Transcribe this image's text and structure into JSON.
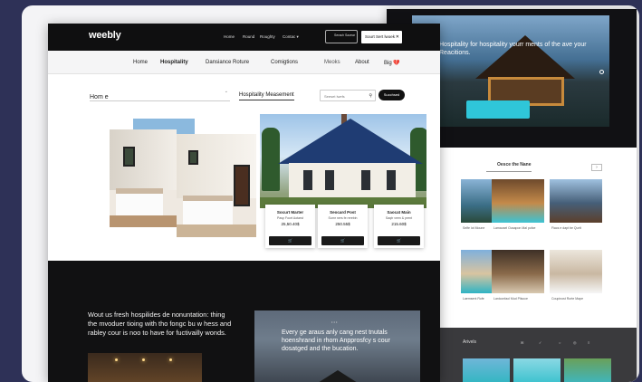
{
  "brand": {
    "logo": "weebly",
    "accent": "#111111",
    "background": "#2e3157"
  },
  "nav_top": {
    "links": [
      "Home",
      "Round",
      "Roughty",
      "Contac ▾"
    ],
    "search_label": "Serach Sazear",
    "cta_label": "Sourt Sert lwoek"
  },
  "nav_main": {
    "items": [
      "Home",
      "Hospitality",
      "Dansiance Roture",
      "Comigtions",
      "Meoks",
      "About",
      "Big 💔"
    ]
  },
  "home_select": {
    "label": "Hom e"
  },
  "marketplace": {
    "title": "Hospitality Measement",
    "search_placeholder": "Seeset lwefs",
    "submit_label": "Succhsed"
  },
  "products": [
    {
      "name": "Socurt Marter",
      "desc": "Pasp Foort Aotarst",
      "price": "25,50.40$"
    },
    {
      "name": "Seocard Post",
      "desc": "Sumr ners fe rerebin",
      "price": "250.55$"
    },
    {
      "name": "Saocat Main",
      "desc": "Saqtr veen & prent",
      "price": "215.60$"
    }
  ],
  "product_button_icon": "cart-icon",
  "dark_section": {
    "paragraph": "Wout us fresh hospilides de nonuntation: thing the mvoduer tioing with tho fongc bu w hess and rabley cour is noo to have for fuctivailly wonds.",
    "quote": "Every ge araus anly cang nest tnutals hoenshrand in rhom Anpprosfcy s cour dosatged and the bucation."
  },
  "back_page": {
    "hero_text": "Hospitality for hospitality yourr ments of the ave your Reacitions.",
    "section_title": "Oesce the Nane",
    "section_btn": "›",
    "thumb_captions": [
      "Selfe lot Moune",
      "Lamaosel Ousapon Mal pofce",
      "Fiacs e dapt be Qurtt",
      "Sulfiy Mand",
      "Laniconfaol Mud Plisoce",
      "Laemsent Rofe",
      "Sulfiy Mand",
      "Laniconfaol Mud Plisoce",
      "Coupinost Rorte Mape"
    ],
    "footer_title": "Arivels"
  }
}
